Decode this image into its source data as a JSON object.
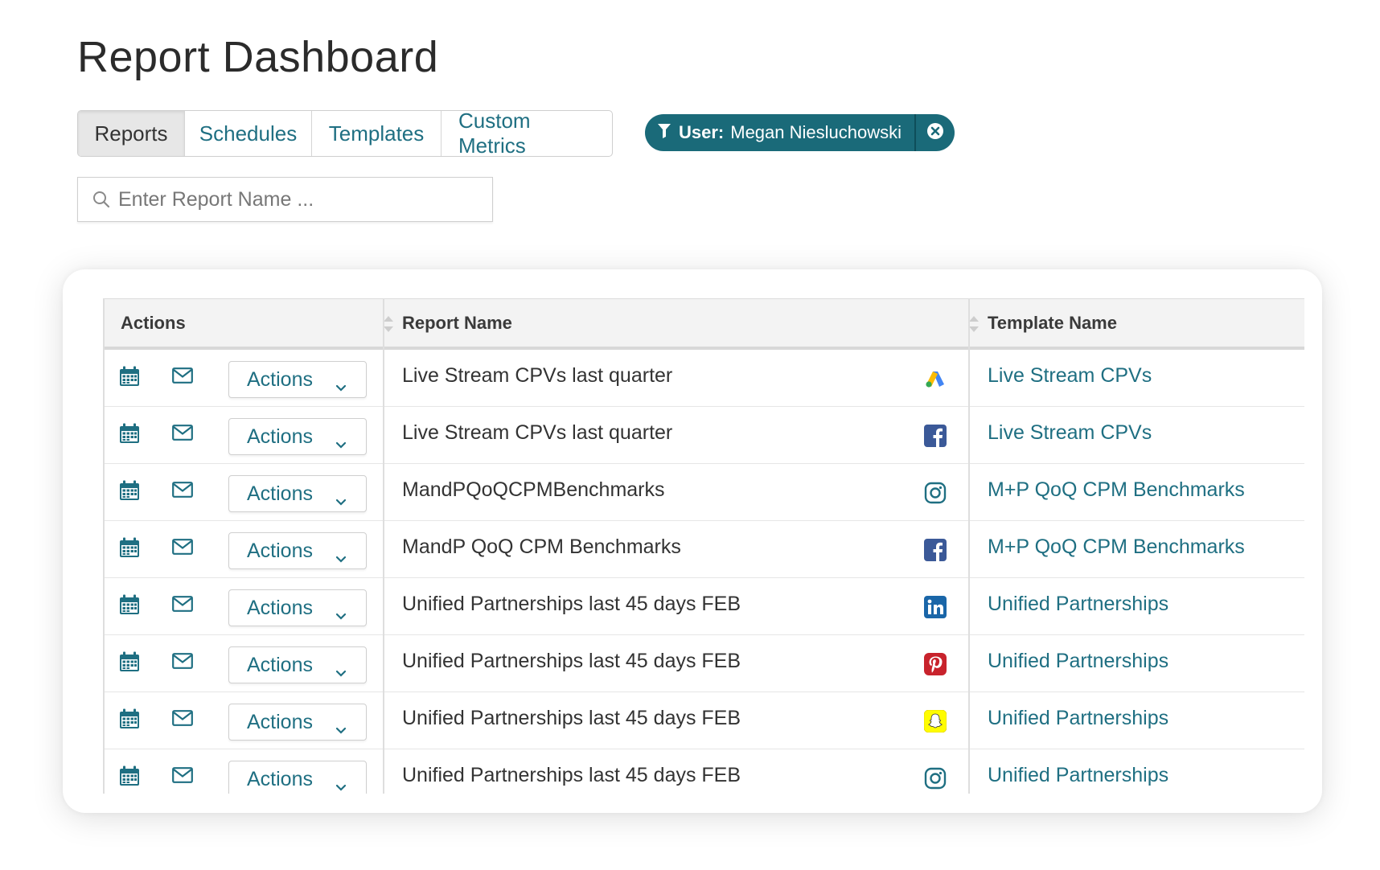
{
  "page": {
    "title": "Report Dashboard"
  },
  "tabs": [
    {
      "label": "Reports",
      "active": true
    },
    {
      "label": "Schedules",
      "active": false
    },
    {
      "label": "Templates",
      "active": false
    },
    {
      "label": "Custom Metrics",
      "active": false
    }
  ],
  "filter_chip": {
    "key": "User:",
    "value": "Megan Niesluchowski",
    "icon": "filter-icon",
    "close_icon": "close-circle-icon",
    "color": "#1a6a79"
  },
  "search": {
    "placeholder": "Enter Report Name ...",
    "value": ""
  },
  "table": {
    "headers": {
      "actions": "Actions",
      "report_name": "Report Name",
      "template_name": "Template Name"
    },
    "action_button_label": "Actions",
    "rows": [
      {
        "report_name": "Live Stream CPVs last quarter",
        "platform": "google-ads-icon",
        "template_name": "Live Stream CPVs"
      },
      {
        "report_name": "Live Stream CPVs last quarter",
        "platform": "facebook-icon",
        "template_name": "Live Stream CPVs"
      },
      {
        "report_name": "MandPQoQCPMBenchmarks",
        "platform": "instagram-icon",
        "template_name": "M+P QoQ CPM Benchmarks"
      },
      {
        "report_name": "MandP QoQ CPM Benchmarks",
        "platform": "facebook-icon",
        "template_name": "M+P QoQ CPM Benchmarks"
      },
      {
        "report_name": "Unified Partnerships last 45 days FEB",
        "platform": "linkedin-icon",
        "template_name": "Unified Partnerships"
      },
      {
        "report_name": "Unified Partnerships last 45 days FEB",
        "platform": "pinterest-icon",
        "template_name": "Unified Partnerships"
      },
      {
        "report_name": "Unified Partnerships last 45 days FEB",
        "platform": "snapchat-icon",
        "template_name": "Unified Partnerships"
      },
      {
        "report_name": "Unified Partnerships last 45 days FEB",
        "platform": "instagram-icon",
        "template_name": "Unified Partnerships"
      }
    ]
  },
  "colors": {
    "accent": "#1f6f82",
    "facebook": "#3b5998",
    "linkedin": "#0e76a8",
    "pinterest": "#c8232c",
    "snapchat": "#fffc00"
  }
}
